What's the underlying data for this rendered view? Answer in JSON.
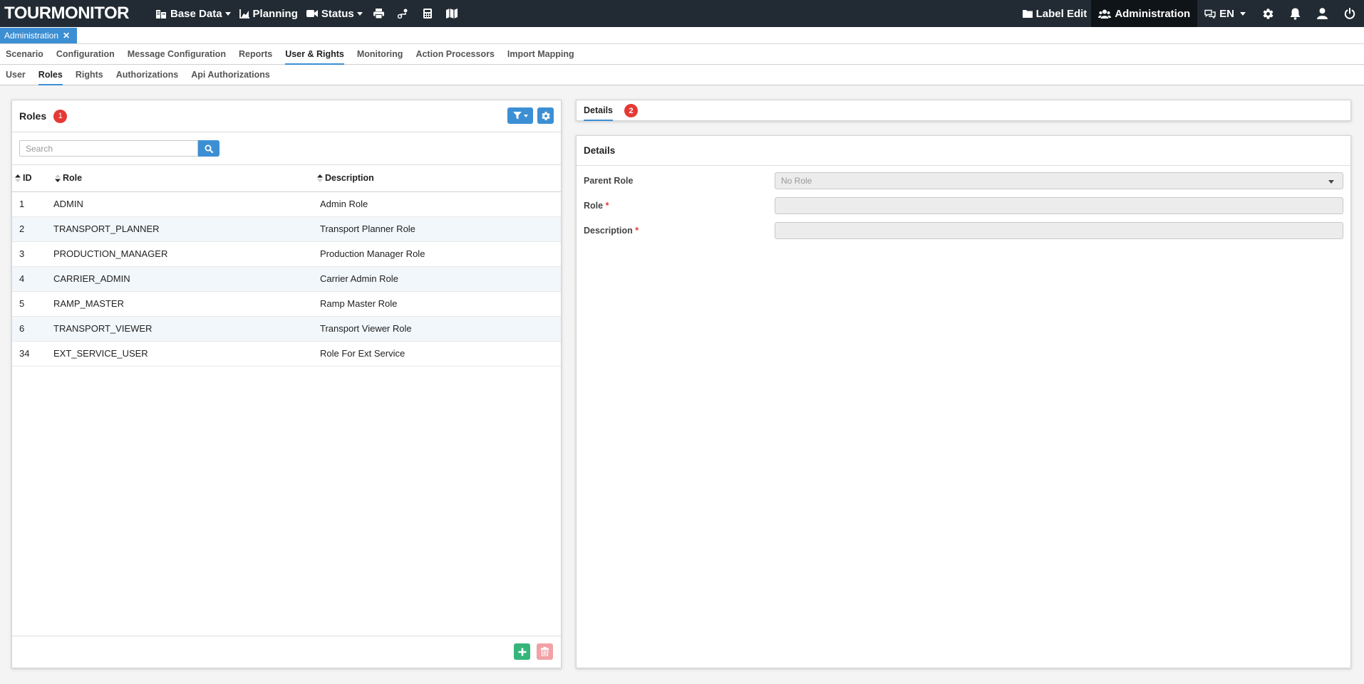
{
  "app": {
    "logo": "TOURMONITOR"
  },
  "topnav": {
    "base_data": "Base Data",
    "planning": "Planning",
    "status": "Status",
    "label_edit": "Label Edit",
    "administration": "Administration",
    "language": "EN"
  },
  "open_tab": {
    "label": "Administration"
  },
  "menu": {
    "items": [
      "Scenario",
      "Configuration",
      "Message Configuration",
      "Reports",
      "User & Rights",
      "Monitoring",
      "Action Processors",
      "Import Mapping"
    ],
    "active": "User & Rights"
  },
  "submenu": {
    "items": [
      "User",
      "Roles",
      "Rights",
      "Authorizations",
      "Api Authorizations"
    ],
    "active": "Roles"
  },
  "roles_panel": {
    "title": "Roles",
    "badge": "1",
    "search_placeholder": "Search",
    "columns": [
      "ID",
      "Role",
      "Description"
    ],
    "rows": [
      {
        "id": "1",
        "role": "ADMIN",
        "description": "Admin Role"
      },
      {
        "id": "2",
        "role": "TRANSPORT_PLANNER",
        "description": "Transport Planner Role"
      },
      {
        "id": "3",
        "role": "PRODUCTION_MANAGER",
        "description": "Production Manager Role"
      },
      {
        "id": "4",
        "role": "CARRIER_ADMIN",
        "description": "Carrier Admin Role"
      },
      {
        "id": "5",
        "role": "RAMP_MASTER",
        "description": "Ramp Master Role"
      },
      {
        "id": "6",
        "role": "TRANSPORT_VIEWER",
        "description": "Transport Viewer Role"
      },
      {
        "id": "34",
        "role": "EXT_SERVICE_USER",
        "description": "Role For Ext Service"
      }
    ]
  },
  "details_tab": {
    "label": "Details",
    "badge": "2"
  },
  "details_panel": {
    "title": "Details",
    "parent_role_label": "Parent Role",
    "parent_role_value": "No Role",
    "role_label": "Role",
    "description_label": "Description",
    "required_marker": "*"
  },
  "colors": {
    "accent": "#3d8fd4",
    "navbar": "#222b33",
    "badge": "#e53935",
    "add": "#35b57a",
    "delete": "#f2a2a6"
  }
}
